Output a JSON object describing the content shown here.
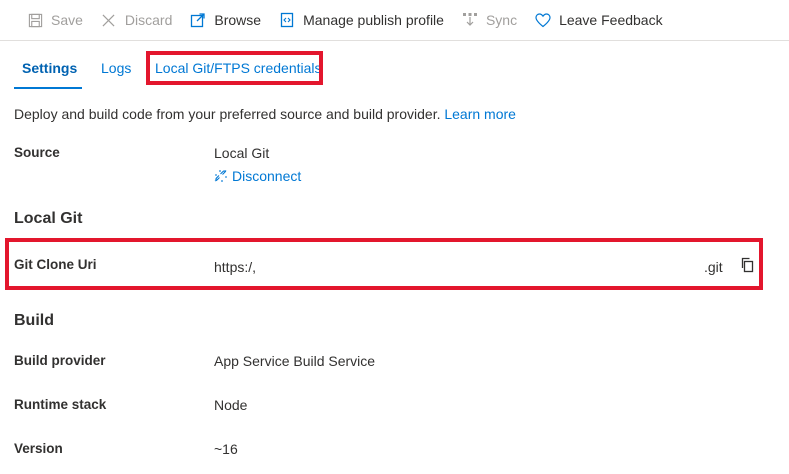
{
  "toolbar": {
    "save_label": "Save",
    "discard_label": "Discard",
    "browse_label": "Browse",
    "manage_publish_label": "Manage publish profile",
    "sync_label": "Sync",
    "feedback_label": "Leave Feedback"
  },
  "tabs": [
    {
      "label": "Settings",
      "active": true
    },
    {
      "label": "Logs",
      "active": false
    },
    {
      "label": "Local Git/FTPS credentials",
      "active": false
    }
  ],
  "description": {
    "text": "Deploy and build code from your preferred source and build provider.",
    "link": "Learn more"
  },
  "source": {
    "label": "Source",
    "value": "Local Git",
    "disconnect": "Disconnect"
  },
  "local_git": {
    "title": "Local Git",
    "clone_uri_label": "Git Clone Uri",
    "clone_uri_value": "https:/,",
    "clone_uri_suffix": ".git"
  },
  "build": {
    "title": "Build",
    "provider_label": "Build provider",
    "provider_value": "App Service Build Service",
    "runtime_label": "Runtime stack",
    "runtime_value": "Node",
    "version_label": "Version",
    "version_value": "~16"
  },
  "colors": {
    "accent": "#0078d4",
    "highlight": "#e3162d",
    "disabled": "#a19f9d",
    "text": "#323130"
  }
}
